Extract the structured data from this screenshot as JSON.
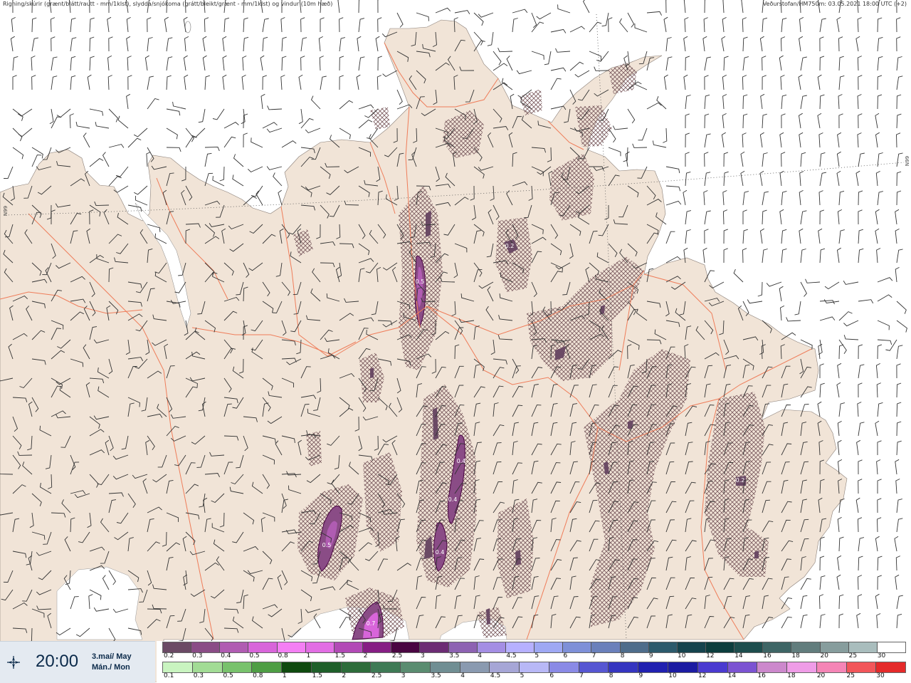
{
  "header": {
    "left_text": "Rigning/skúrir (grænt/blátt/rautt - mm/1klst), slydda/snjókoma (grátt/bleikt/grænt - mm/1klst) og vindur (10m hæð)",
    "right_text": "Veðurstofan/HM750m: 03.05.2021 18:00 UTC (+2)"
  },
  "lat_labels": {
    "left": "N99",
    "right": "N99"
  },
  "time_panel": {
    "time": "20:00",
    "date_line1": "3.maí/ May",
    "date_line2": "Mán./ Mon",
    "icon": "wind-vane-icon"
  },
  "colors": {
    "land": "#f1e4d7",
    "sea": "#ffffff",
    "roads": "#ef7d5a",
    "hatch": "#7a5a5e"
  },
  "precip_labels": [
    "0.2",
    "0.5",
    "0.4",
    "0.4",
    "0.5",
    "0.4",
    "0.7",
    "0.2"
  ],
  "legend": {
    "snow_scale": {
      "labels": [
        "0.2",
        "0.3",
        "0.4",
        "0.5",
        "0.8",
        "1",
        "1.5",
        "2",
        "2.5",
        "3",
        "3.5",
        "4",
        "4.5",
        "5",
        "6",
        "7",
        "8",
        "9",
        "10",
        "12",
        "14",
        "16",
        "18",
        "20",
        "25",
        "30"
      ],
      "colors": [
        "#6b4a65",
        "#8a4c86",
        "#b05cb2",
        "#d865da",
        "#f47ff4",
        "#e26ee4",
        "#b24ab6",
        "#861e84",
        "#4a0642",
        "#6c2c74",
        "#8d62b2",
        "#a48ee4",
        "#b6b0ff",
        "#9ea8f4",
        "#7e90d8",
        "#6a80bb",
        "#4e6d8b",
        "#2c5a6c",
        "#15434d",
        "#0c3d3d",
        "#1d4d4d",
        "#3e6565",
        "#627d7d",
        "#879d9d",
        "#a9bdbd",
        "#ffffff"
      ]
    },
    "rain_scale": {
      "labels": [
        "0.1",
        "0.3",
        "0.5",
        "0.8",
        "1",
        "1.5",
        "2",
        "2.5",
        "3",
        "3.5",
        "4",
        "4.5",
        "5",
        "6",
        "7",
        "8",
        "9",
        "10",
        "12",
        "14",
        "16",
        "18",
        "20",
        "25",
        "30"
      ],
      "colors": [
        "#c9f4c0",
        "#a2dc95",
        "#78c26c",
        "#4e9e44",
        "#0f4a0f",
        "#1e5f29",
        "#2d6c3a",
        "#3e7a55",
        "#5a8c70",
        "#708e93",
        "#8a9ab0",
        "#a6a6d6",
        "#b8b8f6",
        "#8a8ae6",
        "#5656d2",
        "#3535c0",
        "#2020b0",
        "#1b1ba2",
        "#4a3ad0",
        "#7b53d2",
        "#cc88cc",
        "#ef9ce7",
        "#f585b6",
        "#f2565a",
        "#e52a2a"
      ]
    }
  }
}
